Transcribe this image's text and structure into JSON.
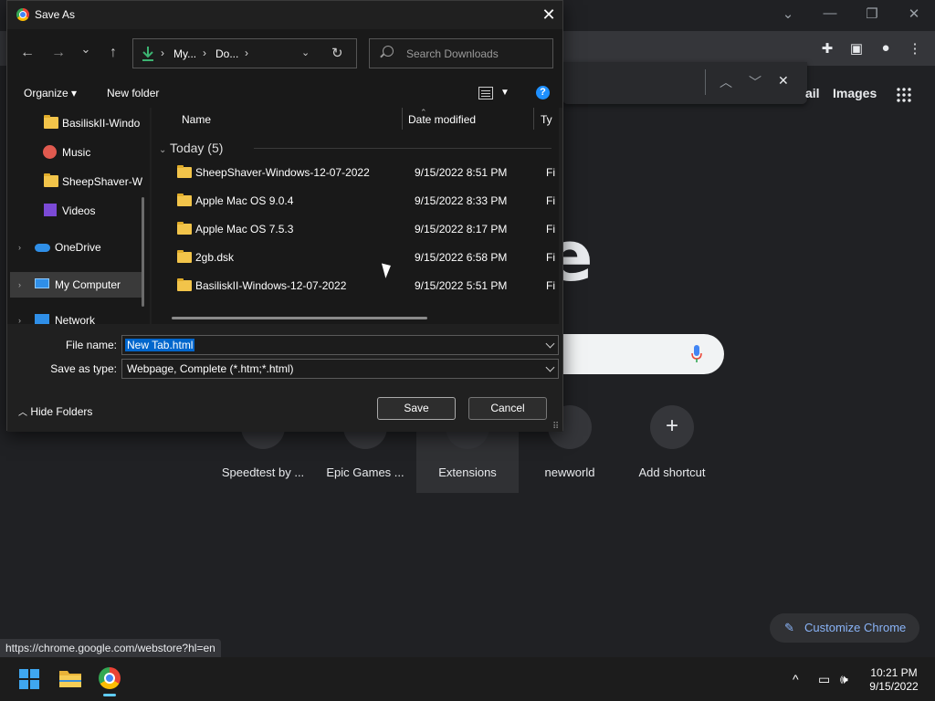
{
  "dialog": {
    "title": "Save As",
    "close_glyph": "✕",
    "nav": {
      "back": "←",
      "forward": "→",
      "recent": "⌄",
      "up": "↑"
    },
    "breadcrumbs": [
      "My...",
      "Do..."
    ],
    "crumb_sep": "›",
    "search_placeholder": "Search Downloads",
    "commands": {
      "organize": "Organize ▾",
      "new_folder": "New folder",
      "help": "?"
    },
    "nav_pane": [
      {
        "label": "BasiliskII-Windo",
        "icon": "folder-icon"
      },
      {
        "label": "Music",
        "icon": "music-icon"
      },
      {
        "label": "SheepShaver-W",
        "icon": "folder-icon"
      },
      {
        "label": "Videos",
        "icon": "video-icon"
      },
      {
        "label": "OneDrive",
        "icon": "cloud-icon"
      },
      {
        "label": "My Computer",
        "icon": "computer-icon"
      },
      {
        "label": "Network",
        "icon": "network-icon"
      }
    ],
    "columns": {
      "name": "Name",
      "date": "Date modified",
      "type": "Ty"
    },
    "group_label": "Today (5)",
    "files": [
      {
        "name": "SheepShaver-Windows-12-07-2022",
        "date": "9/15/2022 8:51 PM",
        "type": "Fi"
      },
      {
        "name": "Apple Mac OS 9.0.4",
        "date": "9/15/2022 8:33 PM",
        "type": "Fi"
      },
      {
        "name": "Apple Mac OS 7.5.3",
        "date": "9/15/2022 8:17 PM",
        "type": "Fi"
      },
      {
        "name": "2gb.dsk",
        "date": "9/15/2022 6:58 PM",
        "type": "Fi"
      },
      {
        "name": "BasiliskII-Windows-12-07-2022",
        "date": "9/15/2022 5:51 PM",
        "type": "Fi"
      }
    ],
    "file_name_label": "File name:",
    "file_name_value": "New Tab.html",
    "save_type_label": "Save as type:",
    "save_type_value": "Webpage, Complete (*.htm;*.html)",
    "hide_folders": "Hide Folders",
    "save_button": "Save",
    "cancel_button": "Cancel"
  },
  "chrome": {
    "ntp_links": {
      "gmail_fragment": "ail",
      "images": "Images"
    },
    "logo_fragment": "e",
    "shortcuts": [
      {
        "label": "Speedtest by ..."
      },
      {
        "label": "Epic Games ..."
      },
      {
        "label": "Extensions"
      },
      {
        "label": "newworld"
      },
      {
        "label": "Add shortcut",
        "glyph": "+"
      }
    ],
    "customize_label": "Customize Chrome",
    "status_url": "https://chrome.google.com/webstore?hl=en"
  },
  "taskbar": {
    "time": "10:21 PM",
    "date": "9/15/2022",
    "tray": {
      "chevron": "^"
    }
  },
  "colors": {
    "accent": "#0066cc",
    "link_blue": "#8ab4f8",
    "win_blue": "#3fa7f0"
  }
}
